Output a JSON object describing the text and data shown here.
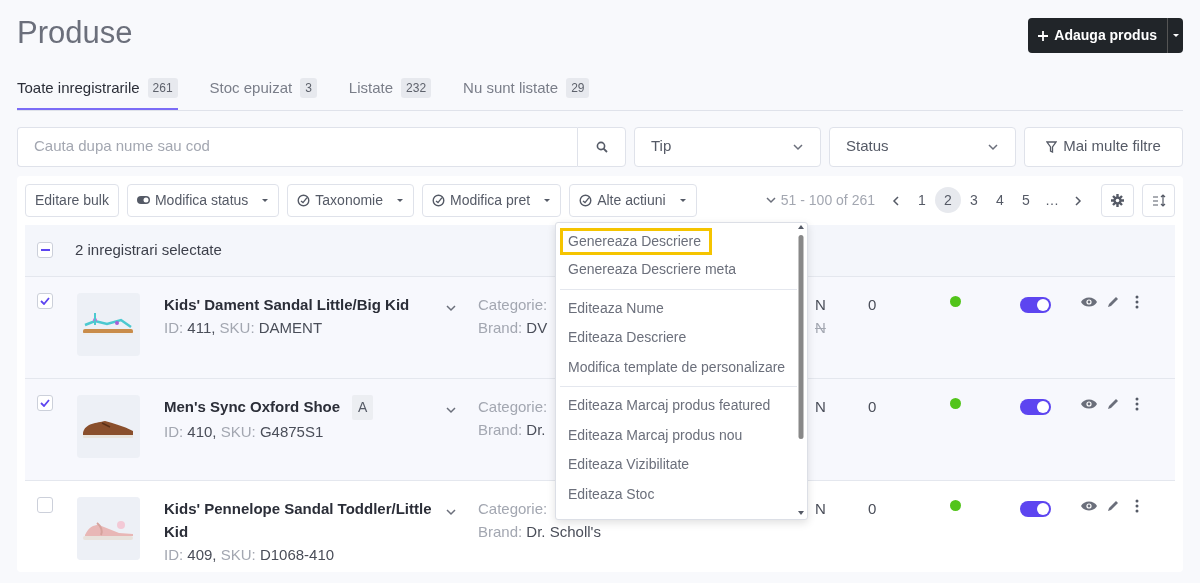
{
  "page_title": "Produse",
  "add_button": {
    "label": "Adauga produs"
  },
  "tabs": [
    {
      "label": "Toate inregistrarile",
      "count": "261",
      "selected": true
    },
    {
      "label": "Stoc epuizat",
      "count": "3",
      "selected": false
    },
    {
      "label": "Listate",
      "count": "232",
      "selected": false
    },
    {
      "label": "Nu sunt listate",
      "count": "29",
      "selected": false
    }
  ],
  "search": {
    "placeholder": "Cauta dupa nume sau cod"
  },
  "filters": [
    {
      "label": "Tip",
      "kind": "select"
    },
    {
      "label": "Status",
      "kind": "select"
    },
    {
      "label": "Mai multe filtre",
      "kind": "button"
    }
  ],
  "toolbar": {
    "actions": [
      {
        "label": "Editare bulk",
        "kind": "plain"
      },
      {
        "label": "Modifica status",
        "kind": "toggle"
      },
      {
        "label": "Taxonomie",
        "kind": "check"
      },
      {
        "label": "Modifica pret",
        "kind": "check"
      },
      {
        "label": "Alte actiuni",
        "kind": "check"
      }
    ],
    "range": "51 - 100 of 261",
    "pages": [
      {
        "label": "1",
        "selected": false
      },
      {
        "label": "2",
        "selected": true
      },
      {
        "label": "3",
        "selected": false
      },
      {
        "label": "4",
        "selected": false
      },
      {
        "label": "5",
        "selected": false
      },
      {
        "label": "…",
        "selected": false
      }
    ]
  },
  "selection": {
    "label": "2 inregistrari selectate",
    "indeterminate": true
  },
  "rows": [
    {
      "checked": true,
      "name": "Kids' Dament Sandal Little/Big Kid",
      "id_label": "ID:",
      "id": "411,",
      "sku_label": "SKU:",
      "sku": "DAMENT",
      "category_label": "Categorie:",
      "brand_label": "Brand:",
      "brand": "DV",
      "prices": [
        {
          "text": "N",
          "struck": false
        },
        {
          "text": "N",
          "struck": true
        }
      ],
      "stock": "0",
      "enabled": true
    },
    {
      "checked": true,
      "name": "Men's Sync Oxford Shoe",
      "badge": "A",
      "id_label": "ID:",
      "id": "410,",
      "sku_label": "SKU:",
      "sku": "G4875S1",
      "category_label": "Categorie:",
      "brand_label": "Brand:",
      "brand": "Dr.",
      "prices": [
        {
          "text": "N",
          "struck": false
        }
      ],
      "stock": "0",
      "enabled": true
    },
    {
      "checked": false,
      "name": "Kids' Pennelope Sandal Toddler/Little Kid",
      "id_label": "ID:",
      "id": "409,",
      "sku_label": "SKU:",
      "sku": "D1068-410",
      "category_label": "Categorie:",
      "brand_label": "Brand:",
      "brand": "Dr. Scholl's",
      "prices": [
        {
          "text": "N",
          "struck": false
        }
      ],
      "stock": "0",
      "enabled": true
    }
  ],
  "dropdown": {
    "groups": [
      [
        {
          "label": "Genereaza Descriere",
          "focused": true
        },
        {
          "label": "Genereaza Descriere meta",
          "focused": false
        }
      ],
      [
        {
          "label": "Editeaza Nume",
          "focused": false
        },
        {
          "label": "Editeaza Descriere",
          "focused": false
        },
        {
          "label": "Modifica template de personalizare",
          "focused": false
        }
      ],
      [
        {
          "label": "Editeaza Marcaj produs featured",
          "focused": false
        },
        {
          "label": "Editeaza Marcaj produs nou",
          "focused": false
        },
        {
          "label": "Editeaza Vizibilitate",
          "focused": false
        },
        {
          "label": "Editeaza Stoc",
          "focused": false
        }
      ]
    ]
  }
}
